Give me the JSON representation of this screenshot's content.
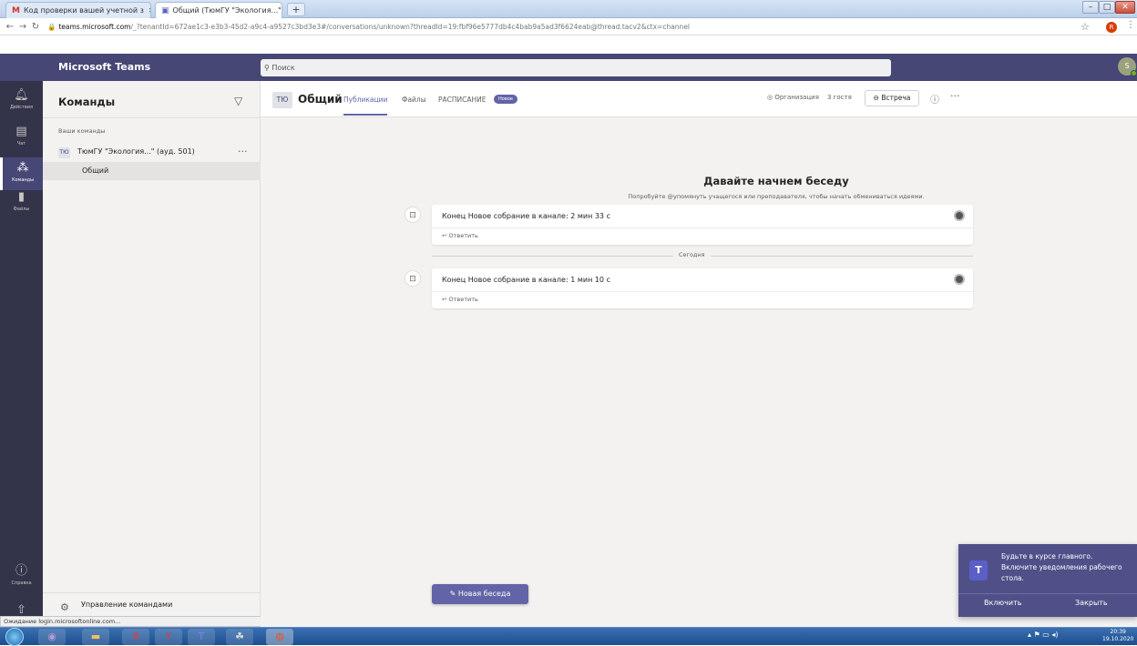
{
  "browser": {
    "tabs": [
      {
        "label": "Код проверки вашей учетной з",
        "icon": "gmail-icon"
      },
      {
        "label": "Общий (ТюмГУ \"Экология...\" (а;",
        "icon": "teams-icon"
      }
    ],
    "new_tab": "+",
    "url_host": "teams.microsoft.com",
    "url_path": "/_?tenantId=672ae1c3-e3b3-45d2-a9c4-a9527c3bd3e3#/conversations/unknown?threadId=19:fbf96e5777db4c4bab9a5ad3f6624eab@thread.tacv2&ctx=channel",
    "profile_initial": "R"
  },
  "teams": {
    "app_name": "Microsoft Teams",
    "search_placeholder": "Поиск",
    "user_initial": "S"
  },
  "rail": [
    {
      "label": "Действия",
      "icon": "bell-icon"
    },
    {
      "label": "Чат",
      "icon": "chat-icon"
    },
    {
      "label": "Команды",
      "icon": "teams-icon",
      "active": true
    },
    {
      "label": "Файлы",
      "icon": "file-icon"
    }
  ],
  "rail_bottom": {
    "help_label": "Справка"
  },
  "panel": {
    "title": "Команды",
    "section_label": "Ваши команды",
    "team_avatar": "ТЮ",
    "team_name": "ТюмГУ \"Экология...\" (ауд. 501)",
    "channel_name": "Общий",
    "manage_label": "Управление командами"
  },
  "status_bar": "Ожидание login.microsoftonline.com...",
  "channel": {
    "avatar": "ТЮ",
    "title": "Общий",
    "tabs": [
      "Публикации",
      "Файлы",
      "РАСПИСАНИЕ"
    ],
    "new_badge": "Новое",
    "org_label": "Организация",
    "guests": "3 гостя",
    "meet_label": "Встреча"
  },
  "conversation": {
    "heading": "Давайте начнем беседу",
    "subheading": "Попробуйте @упомянуть учащегося или преподавателя, чтобы начать обмениваться идеями.",
    "messages": [
      {
        "text": "Конец Новое собрание в канале: 2 мин 33 с",
        "reply": "Ответить"
      },
      {
        "text": "Конец Новое собрание в канале: 1 мин 10 с",
        "reply": "Ответить"
      }
    ],
    "date_separator": "Сегодня",
    "new_conversation": "Новая беседа"
  },
  "toast": {
    "text": "Будьте в курсе главного. Включите уведомления рабочего стола.",
    "enable": "Включить",
    "close": "Закрыть"
  },
  "taskbar": {
    "time": "20:39",
    "date": "19.10.2020"
  },
  "colors": {
    "teams_header": "#464775",
    "rail": "#33344a",
    "accent": "#6264a7"
  }
}
